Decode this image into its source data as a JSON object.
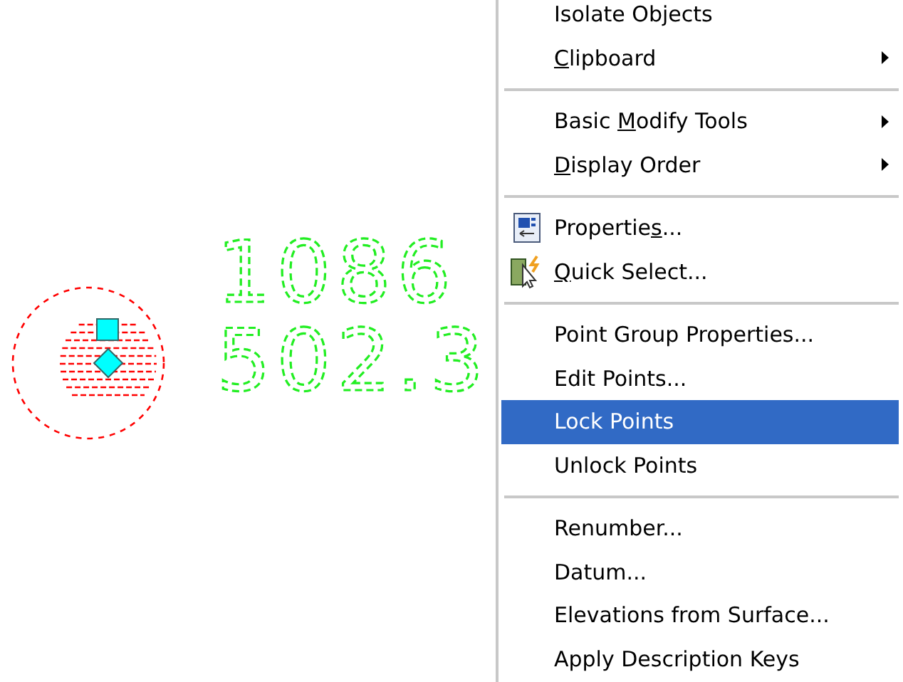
{
  "drawing": {
    "labels": [
      "1086",
      "502.3"
    ]
  },
  "menu": {
    "items": [
      {
        "kind": "item",
        "label": "Isolate Objects",
        "selected": false
      },
      {
        "kind": "item",
        "label_parts": {
          "key": "C",
          "after": "lipboard"
        },
        "submenu": true,
        "selected": false
      },
      {
        "kind": "separator"
      },
      {
        "kind": "item",
        "label_parts": {
          "before": "Basic ",
          "key": "M",
          "after": "odify Tools"
        },
        "submenu": true,
        "selected": false
      },
      {
        "kind": "item",
        "label_parts": {
          "key": "D",
          "after": "isplay Order"
        },
        "submenu": true,
        "selected": false
      },
      {
        "kind": "separator"
      },
      {
        "kind": "properties",
        "label_parts": {
          "before": "Propertie",
          "key": "s",
          "after": "..."
        },
        "selected": false
      },
      {
        "kind": "quickselect",
        "label_parts": {
          "key": "Q",
          "after": "uick Select..."
        },
        "selected": false
      },
      {
        "kind": "separator"
      },
      {
        "kind": "item",
        "label": "Point Group Properties...",
        "selected": false
      },
      {
        "kind": "item",
        "label": "Edit Points...",
        "selected": false
      },
      {
        "kind": "item",
        "label": "Lock Points",
        "selected": true
      },
      {
        "kind": "item",
        "label": "Unlock Points",
        "selected": false
      },
      {
        "kind": "separator"
      },
      {
        "kind": "item",
        "label": "Renumber...",
        "selected": false
      },
      {
        "kind": "item",
        "label": "Datum...",
        "selected": false
      },
      {
        "kind": "item",
        "label": "Elevations from Surface...",
        "selected": false
      },
      {
        "kind": "item",
        "label": "Apply Description Keys",
        "selected": false
      }
    ]
  }
}
